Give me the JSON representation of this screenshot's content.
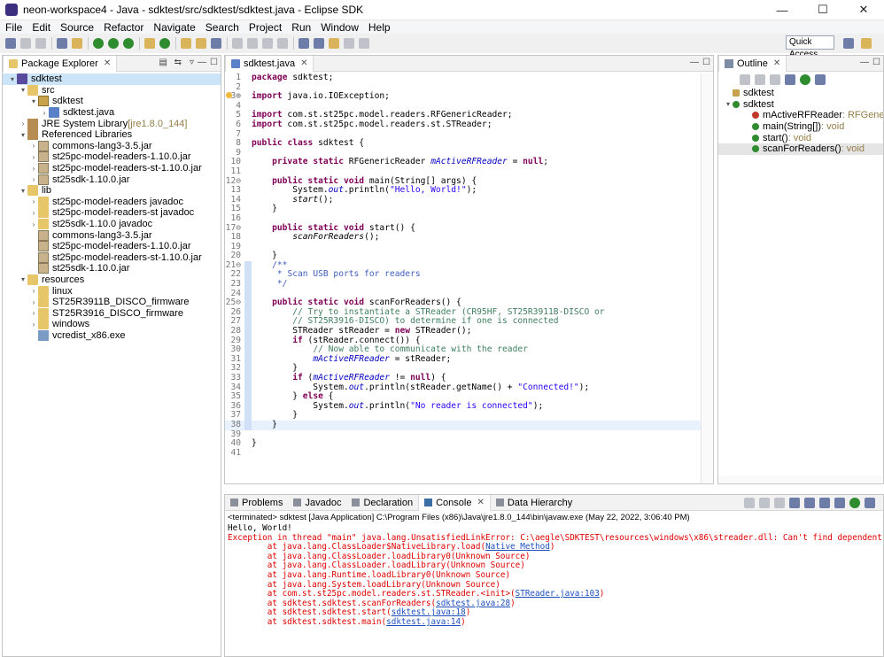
{
  "window": {
    "title": "neon-workspace4 - Java - sdktest/src/sdktest/sdktest.java - Eclipse SDK",
    "minimize": "—",
    "maximize": "☐",
    "close": "✕"
  },
  "menu": [
    "File",
    "Edit",
    "Source",
    "Refactor",
    "Navigate",
    "Search",
    "Project",
    "Run",
    "Window",
    "Help"
  ],
  "quick_access": "Quick Access",
  "package_explorer": {
    "tab": "Package Explorer",
    "items": [
      {
        "label": "sdktest",
        "indent": 0,
        "icon": "project-icon",
        "tw": "▾"
      },
      {
        "label": "src",
        "indent": 1,
        "icon": "folder-icon",
        "tw": "▾"
      },
      {
        "label": "sdktest",
        "indent": 2,
        "icon": "package-icon",
        "tw": "▾"
      },
      {
        "label": "sdktest.java",
        "indent": 3,
        "icon": "java-file-icon",
        "tw": "›"
      },
      {
        "label": "JRE System Library",
        "suffix": "[jre1.8.0_144]",
        "indent": 1,
        "icon": "library-icon",
        "tw": "›"
      },
      {
        "label": "Referenced Libraries",
        "indent": 1,
        "icon": "library-icon",
        "tw": "▾"
      },
      {
        "label": "commons-lang3-3.5.jar",
        "indent": 2,
        "icon": "jar-icon",
        "tw": "›"
      },
      {
        "label": "st25pc-model-readers-1.10.0.jar",
        "indent": 2,
        "icon": "jar-icon",
        "tw": "›"
      },
      {
        "label": "st25pc-model-readers-st-1.10.0.jar",
        "indent": 2,
        "icon": "jar-icon",
        "tw": "›"
      },
      {
        "label": "st25sdk-1.10.0.jar",
        "indent": 2,
        "icon": "jar-icon",
        "tw": "›"
      },
      {
        "label": "lib",
        "indent": 1,
        "icon": "folder-icon",
        "tw": "▾"
      },
      {
        "label": "st25pc-model-readers javadoc",
        "indent": 2,
        "icon": "folder-icon",
        "tw": "›"
      },
      {
        "label": "st25pc-model-readers-st javadoc",
        "indent": 2,
        "icon": "folder-icon",
        "tw": "›"
      },
      {
        "label": "st25sdk-1.10.0 javadoc",
        "indent": 2,
        "icon": "folder-icon",
        "tw": "›"
      },
      {
        "label": "commons-lang3-3.5.jar",
        "indent": 2,
        "icon": "jar-icon",
        "tw": ""
      },
      {
        "label": "st25pc-model-readers-1.10.0.jar",
        "indent": 2,
        "icon": "jar-icon",
        "tw": ""
      },
      {
        "label": "st25pc-model-readers-st-1.10.0.jar",
        "indent": 2,
        "icon": "jar-icon",
        "tw": ""
      },
      {
        "label": "st25sdk-1.10.0.jar",
        "indent": 2,
        "icon": "jar-icon",
        "tw": ""
      },
      {
        "label": "resources",
        "indent": 1,
        "icon": "folder-icon",
        "tw": "▾"
      },
      {
        "label": "linux",
        "indent": 2,
        "icon": "folder-icon",
        "tw": "›"
      },
      {
        "label": "ST25R3911B_DISCO_firmware",
        "indent": 2,
        "icon": "folder-icon",
        "tw": "›"
      },
      {
        "label": "ST25R3916_DISCO_firmware",
        "indent": 2,
        "icon": "folder-icon",
        "tw": "›"
      },
      {
        "label": "windows",
        "indent": 2,
        "icon": "folder-icon",
        "tw": "›"
      },
      {
        "label": "vcredist_x86.exe",
        "indent": 2,
        "icon": "exe-icon",
        "tw": ""
      }
    ]
  },
  "editor": {
    "tab": "sdktest.java",
    "lines": [
      {
        "n": "1",
        "html": "<span class='kw'>package</span> sdktest;"
      },
      {
        "n": "2",
        "html": ""
      },
      {
        "n": "3⊕",
        "html": "<span class='kw'>import</span> java.io.IOException;"
      },
      {
        "n": "4",
        "html": ""
      },
      {
        "n": "5",
        "html": "<span class='kw'>import</span> com.st.st25pc.model.readers.RFGenericReader;"
      },
      {
        "n": "6",
        "html": "<span class='kw'>import</span> com.st.st25pc.model.readers.st.STReader;"
      },
      {
        "n": "7",
        "html": ""
      },
      {
        "n": "8",
        "html": "<span class='kw'>public</span> <span class='kw'>class</span> sdktest {"
      },
      {
        "n": "9",
        "html": ""
      },
      {
        "n": "10",
        "html": "    <span class='kw'>private</span> <span class='kw'>static</span> RFGenericReader <span class='fld'>mActiveRFReader</span> = <span class='kw'>null</span>;"
      },
      {
        "n": "11",
        "html": ""
      },
      {
        "n": "12⊖",
        "html": "    <span class='kw'>public</span> <span class='kw'>static</span> <span class='kw'>void</span> main(String[] args) {"
      },
      {
        "n": "13",
        "html": "        System.<span class='fld'>out</span>.println(<span class='str'>\"Hello, World!\"</span>);"
      },
      {
        "n": "14",
        "html": "        <span class='ital'>start</span>();"
      },
      {
        "n": "15",
        "html": "    }"
      },
      {
        "n": "16",
        "html": ""
      },
      {
        "n": "17⊖",
        "html": "    <span class='kw'>public</span> <span class='kw'>static</span> <span class='kw'>void</span> start() {"
      },
      {
        "n": "18",
        "html": "        <span class='ital'>scanForReaders</span>();"
      },
      {
        "n": "19",
        "html": ""
      },
      {
        "n": "20",
        "html": "    }"
      },
      {
        "n": "21⊖",
        "html": "    <span class='doc'>/**</span>"
      },
      {
        "n": "22",
        "html": "     <span class='doc'>* Scan USB ports for readers</span>"
      },
      {
        "n": "23",
        "html": "     <span class='doc'>*/</span>"
      },
      {
        "n": "24",
        "html": ""
      },
      {
        "n": "25⊖",
        "html": "    <span class='kw'>public</span> <span class='kw'>static</span> <span class='kw'>void</span> scanForReaders() {"
      },
      {
        "n": "26",
        "html": "        <span class='cmt'>// Try to instantiate a STReader (CR95HF, ST25R3911B-DISCO or</span>"
      },
      {
        "n": "27",
        "html": "        <span class='cmt'>// ST25R3916-DISCO) to determine if one is connected</span>"
      },
      {
        "n": "28",
        "html": "        STReader stReader = <span class='kw'>new</span> STReader();"
      },
      {
        "n": "29",
        "html": "        <span class='kw'>if</span> (stReader.connect()) {"
      },
      {
        "n": "30",
        "html": "            <span class='cmt'>// Now able to communicate with the reader</span>"
      },
      {
        "n": "31",
        "html": "            <span class='fld'>mActiveRFReader</span> = stReader;"
      },
      {
        "n": "32",
        "html": "        }"
      },
      {
        "n": "33",
        "html": "        <span class='kw'>if</span> (<span class='fld'>mActiveRFReader</span> != <span class='kw'>null</span>) {"
      },
      {
        "n": "34",
        "html": "            System.<span class='fld'>out</span>.println(stReader.getName() + <span class='str'>\"Connected!\"</span>);"
      },
      {
        "n": "35",
        "html": "        } <span class='kw'>else</span> {"
      },
      {
        "n": "36",
        "html": "            System.<span class='fld'>out</span>.println(<span class='str'>\"No reader is connected\"</span>);"
      },
      {
        "n": "37",
        "html": "        }"
      },
      {
        "n": "38",
        "html": "    }",
        "hl": true
      },
      {
        "n": "39",
        "html": ""
      },
      {
        "n": "40",
        "html": "}"
      },
      {
        "n": "41",
        "html": ""
      }
    ]
  },
  "outline": {
    "tab": "Outline",
    "items": [
      {
        "label": "sdktest",
        "indent": 0,
        "icon": "package-icon",
        "tw": ""
      },
      {
        "label": "sdktest",
        "indent": 0,
        "icon": "class-icon",
        "tw": "▾"
      },
      {
        "label": "mActiveRFReader",
        "type": " : RFGenericReader",
        "indent": 1,
        "icon": "field-icon"
      },
      {
        "label": "main(String[])",
        "type": " : void",
        "indent": 1,
        "icon": "method-icon"
      },
      {
        "label": "start()",
        "type": " : void",
        "indent": 1,
        "icon": "method-icon"
      },
      {
        "label": "scanForReaders()",
        "type": " : void",
        "indent": 1,
        "icon": "method-icon",
        "sel": true
      }
    ]
  },
  "bottom": {
    "tabs": [
      "Problems",
      "Javadoc",
      "Declaration",
      "Console",
      "Data Hierarchy"
    ],
    "active": 3,
    "console_header": "<terminated> sdktest [Java Application] C:\\Program Files (x86)\\Java\\jre1.8.0_144\\bin\\javaw.exe (May 22, 2022, 3:06:40 PM)",
    "output": [
      {
        "cls": "cout",
        "html": "Hello, World!"
      },
      {
        "cls": "cerr",
        "html": "Exception in thread \"main\" java.lang.UnsatisfiedLinkError: C:\\aegle\\SDKTEST\\resources\\windows\\x86\\streader.dll: Can't find dependent libraries"
      },
      {
        "cls": "cerr",
        "html": "        at java.lang.ClassLoader$NativeLibrary.load(<span class='link'>Native Method</span>)"
      },
      {
        "cls": "cerr",
        "html": "        at java.lang.ClassLoader.loadLibrary0(Unknown Source)"
      },
      {
        "cls": "cerr",
        "html": "        at java.lang.ClassLoader.loadLibrary(Unknown Source)"
      },
      {
        "cls": "cerr",
        "html": "        at java.lang.Runtime.loadLibrary0(Unknown Source)"
      },
      {
        "cls": "cerr",
        "html": "        at java.lang.System.loadLibrary(Unknown Source)"
      },
      {
        "cls": "cerr",
        "html": "        at com.st.st25pc.model.readers.st.STReader.&lt;init&gt;(<span class='link'>STReader.java:103</span>)"
      },
      {
        "cls": "cerr",
        "html": "        at sdktest.sdktest.scanForReaders(<span class='link'>sdktest.java:28</span>)"
      },
      {
        "cls": "cerr",
        "html": "        at sdktest.sdktest.start(<span class='link'>sdktest.java:18</span>)"
      },
      {
        "cls": "cerr",
        "html": "        at sdktest.sdktest.main(<span class='link'>sdktest.java:14</span>)"
      }
    ]
  }
}
